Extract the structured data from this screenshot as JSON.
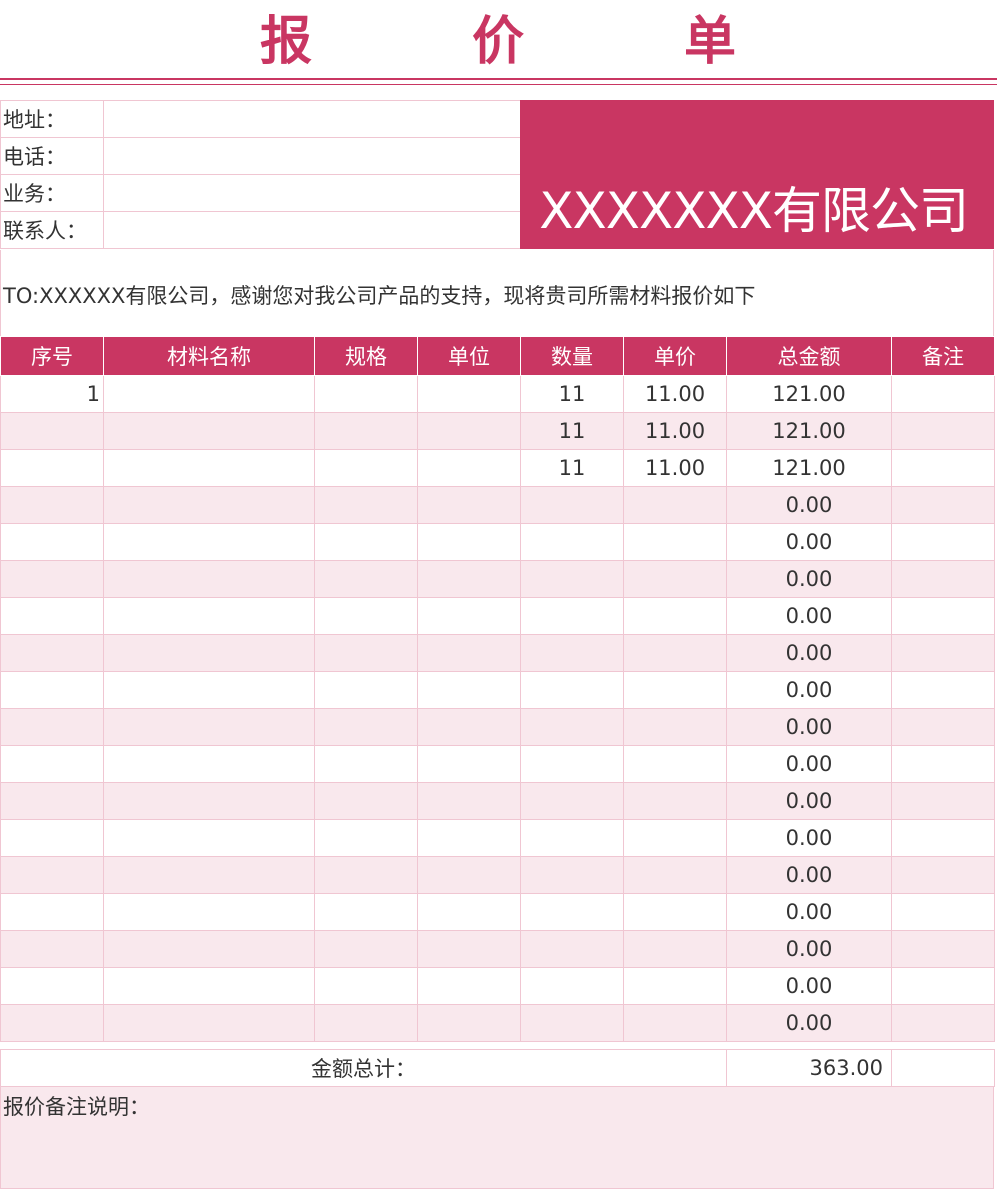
{
  "header": {
    "title_chars": [
      "报",
      "价",
      "单"
    ],
    "company_name": "XXXXXXX有限公司"
  },
  "info": {
    "address_label": "地址：",
    "phone_label": "电话：",
    "business_label": "业务：",
    "contact_label": "联系人："
  },
  "intro_text": "TO:XXXXXX有限公司，感谢您对我公司产品的支持，现将贵司所需材料报价如下",
  "table": {
    "headers": [
      "序号",
      "材料名称",
      "规格",
      "单位",
      "数量",
      "单价",
      "总金额",
      "备注"
    ],
    "rows": [
      [
        "1",
        "",
        "",
        "",
        "11",
        "11.00",
        "121.00",
        ""
      ],
      [
        "",
        "",
        "",
        "",
        "11",
        "11.00",
        "121.00",
        ""
      ],
      [
        "",
        "",
        "",
        "",
        "11",
        "11.00",
        "121.00",
        ""
      ],
      [
        "",
        "",
        "",
        "",
        "",
        "",
        "0.00",
        ""
      ],
      [
        "",
        "",
        "",
        "",
        "",
        "",
        "0.00",
        ""
      ],
      [
        "",
        "",
        "",
        "",
        "",
        "",
        "0.00",
        ""
      ],
      [
        "",
        "",
        "",
        "",
        "",
        "",
        "0.00",
        ""
      ],
      [
        "",
        "",
        "",
        "",
        "",
        "",
        "0.00",
        ""
      ],
      [
        "",
        "",
        "",
        "",
        "",
        "",
        "0.00",
        ""
      ],
      [
        "",
        "",
        "",
        "",
        "",
        "",
        "0.00",
        ""
      ],
      [
        "",
        "",
        "",
        "",
        "",
        "",
        "0.00",
        ""
      ],
      [
        "",
        "",
        "",
        "",
        "",
        "",
        "0.00",
        ""
      ],
      [
        "",
        "",
        "",
        "",
        "",
        "",
        "0.00",
        ""
      ],
      [
        "",
        "",
        "",
        "",
        "",
        "",
        "0.00",
        ""
      ],
      [
        "",
        "",
        "",
        "",
        "",
        "",
        "0.00",
        ""
      ],
      [
        "",
        "",
        "",
        "",
        "",
        "",
        "0.00",
        ""
      ],
      [
        "",
        "",
        "",
        "",
        "",
        "",
        "0.00",
        ""
      ],
      [
        "",
        "",
        "",
        "",
        "",
        "",
        "0.00",
        ""
      ]
    ]
  },
  "total": {
    "label": "金额总计：",
    "value": "363.00"
  },
  "remark_label": "报价备注说明：",
  "colors": {
    "accent": "#c93662",
    "stripe": "#f9e8ed",
    "border": "#f0c6d2"
  }
}
